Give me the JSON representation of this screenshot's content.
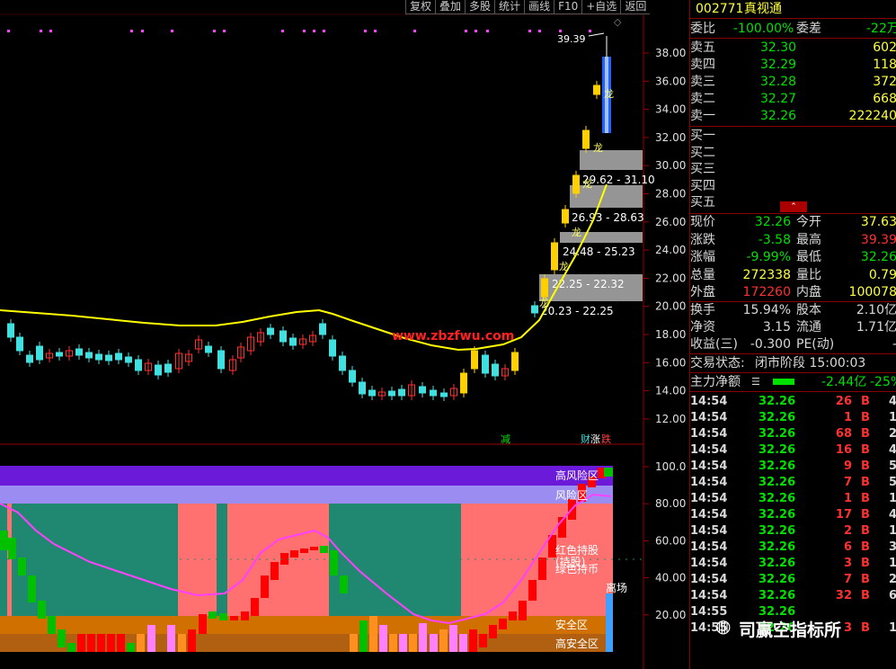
{
  "toolbar": [
    "复权",
    "叠加",
    "多股",
    "统计",
    "画线",
    "F10",
    "+自选",
    "返回"
  ],
  "stock": {
    "code": "002771",
    "name": "真视通"
  },
  "quote": {
    "committee_ratio_label": "委比",
    "committee_ratio": "-100.00%",
    "committee_diff_label": "委差",
    "committee_diff": "-22万",
    "asks": [
      {
        "label": "卖五",
        "price": "32.30",
        "vol": "602"
      },
      {
        "label": "卖四",
        "price": "32.29",
        "vol": "118"
      },
      {
        "label": "卖三",
        "price": "32.28",
        "vol": "372"
      },
      {
        "label": "卖二",
        "price": "32.27",
        "vol": "668"
      },
      {
        "label": "卖一",
        "price": "32.26",
        "vol": "222240"
      }
    ],
    "bids": [
      {
        "label": "买一"
      },
      {
        "label": "买二"
      },
      {
        "label": "买三"
      },
      {
        "label": "买四"
      },
      {
        "label": "买五"
      }
    ],
    "stats": [
      {
        "l1": "现价",
        "v1": "32.26",
        "l2": "今开",
        "v2": "37.63"
      },
      {
        "l1": "涨跌",
        "v1": "-3.58",
        "l2": "最高",
        "v2": "39.39"
      },
      {
        "l1": "涨幅",
        "v1": "-9.99%",
        "l2": "最低",
        "v2": "32.26"
      },
      {
        "l1": "总量",
        "v1": "272338",
        "l2": "量比",
        "v2": "0.79"
      },
      {
        "l1": "外盘",
        "v1": "172260",
        "l2": "内盘",
        "v2": "100078"
      }
    ],
    "stats2": [
      {
        "l1": "换手",
        "v1": "15.94%",
        "l2": "股本",
        "v2": "2.10亿"
      },
      {
        "l1": "净资",
        "v1": "3.15",
        "l2": "流通",
        "v2": "1.71亿"
      },
      {
        "l1": "收益(三)",
        "v1": "-0.300",
        "l2": "PE(动)",
        "v2": "-"
      }
    ],
    "trade_state_label": "交易状态:",
    "trade_state": "闭市阶段 15:00:03",
    "main_net_label": "主力净额",
    "main_net": "-2.44亿",
    "main_net_pct": "-25%"
  },
  "ticks": [
    {
      "t": "14:54",
      "p": "32.26",
      "v": "26",
      "bs": "B",
      "n": "4"
    },
    {
      "t": "14:54",
      "p": "32.26",
      "v": "1",
      "bs": "B",
      "n": "1"
    },
    {
      "t": "14:54",
      "p": "32.26",
      "v": "68",
      "bs": "B",
      "n": "2"
    },
    {
      "t": "14:54",
      "p": "32.26",
      "v": "16",
      "bs": "B",
      "n": "4"
    },
    {
      "t": "14:54",
      "p": "32.26",
      "v": "9",
      "bs": "B",
      "n": "5"
    },
    {
      "t": "14:54",
      "p": "32.26",
      "v": "7",
      "bs": "B",
      "n": "5"
    },
    {
      "t": "14:54",
      "p": "32.26",
      "v": "1",
      "bs": "B",
      "n": "1"
    },
    {
      "t": "14:54",
      "p": "32.26",
      "v": "17",
      "bs": "B",
      "n": "4"
    },
    {
      "t": "14:54",
      "p": "32.26",
      "v": "2",
      "bs": "B",
      "n": "1"
    },
    {
      "t": "14:54",
      "p": "32.26",
      "v": "6",
      "bs": "B",
      "n": "3"
    },
    {
      "t": "14:54",
      "p": "32.26",
      "v": "3",
      "bs": "B",
      "n": "1"
    },
    {
      "t": "14:54",
      "p": "32.26",
      "v": "7",
      "bs": "B",
      "n": "2"
    },
    {
      "t": "14:54",
      "p": "32.26",
      "v": "32",
      "bs": "B",
      "n": "6"
    },
    {
      "t": "14:55",
      "p": "32.26",
      "v": "",
      "bs": "",
      "n": ""
    },
    {
      "t": "14:55",
      "p": "32.26",
      "v": "3",
      "bs": "B",
      "n": "1"
    }
  ],
  "main_chart": {
    "y_ticks": [
      "38.00",
      "36.00",
      "34.00",
      "32.00",
      "30.00",
      "28.00",
      "26.00",
      "24.00",
      "22.00",
      "20.00",
      "18.00",
      "16.00",
      "14.00",
      "12.00"
    ],
    "high_label": "39.39",
    "watermark": "www.zbzfwu.com",
    "zones": [
      "29.62 - 31.10",
      "26.93 - 28.63",
      "24.48 - 25.23",
      "22.25 - 22.32",
      "20.23 - 22.25"
    ],
    "dragon": "龙",
    "bottom_marks": [
      "减",
      "财",
      "涨",
      "跌"
    ]
  },
  "sub_chart": {
    "y_ticks": [
      "100.0",
      "80.00",
      "60.00",
      "40.00",
      "20.00"
    ],
    "labels": {
      "high_risk": "高风险区",
      "risk": "风险区",
      "hold1": "红色持股",
      "hold2": "(持股)",
      "hold3": "绿色持币",
      "leave": "离场",
      "safe": "安全区",
      "high_safe": "高安全区"
    }
  },
  "brand_watermark": "司赢空指标所",
  "colors": {
    "up": "#ff3030",
    "down": "#40e0e0",
    "band_purple": "#6a1ad8",
    "band_lavender": "#9a8cf0",
    "pink": "#ff7070",
    "teal": "#208870",
    "orange": "#d07000"
  }
}
